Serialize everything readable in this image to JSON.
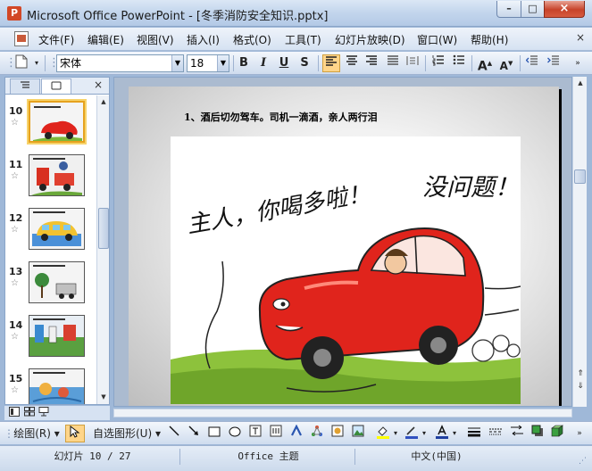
{
  "window": {
    "title": "Microsoft Office PowerPoint - [冬季消防安全知识.pptx]",
    "icon": "powerpoint-icon",
    "minimize": "–",
    "maximize": "□",
    "close": "×"
  },
  "menu": {
    "items": [
      {
        "label": "文件(F)"
      },
      {
        "label": "编辑(E)"
      },
      {
        "label": "视图(V)"
      },
      {
        "label": "插入(I)"
      },
      {
        "label": "格式(O)"
      },
      {
        "label": "工具(T)"
      },
      {
        "label": "幻灯片放映(D)"
      },
      {
        "label": "窗口(W)"
      },
      {
        "label": "帮助(H)"
      }
    ],
    "close_glyph": "×"
  },
  "toolbar": {
    "font_name": "宋体",
    "font_size": "18",
    "bold": "B",
    "italic": "I",
    "underline": "U",
    "shadow": "S",
    "grow_font": "A",
    "shrink_font": "A"
  },
  "panel": {
    "close_glyph": "×",
    "slides": [
      {
        "number": "10",
        "selected": true
      },
      {
        "number": "11",
        "selected": false
      },
      {
        "number": "12",
        "selected": false
      },
      {
        "number": "13",
        "selected": false
      },
      {
        "number": "14",
        "selected": false
      },
      {
        "number": "15",
        "selected": false
      }
    ]
  },
  "slide": {
    "title": "1、酒后切勿驾车。司机一滴酒，亲人两行泪",
    "cartoon_text_left": "主人，你喝多啦！",
    "cartoon_text_right": "没问题！"
  },
  "drawbar": {
    "draw_label": "绘图(R)",
    "autoshapes_label": "自选图形(U)"
  },
  "status": {
    "slide_position": "幻灯片 10 / 27",
    "theme": "Office 主题",
    "language": "中文(中国)"
  },
  "colors": {
    "car_red": "#e0241c",
    "grass_green": "#8dc23c",
    "selection": "#e6a21e"
  }
}
